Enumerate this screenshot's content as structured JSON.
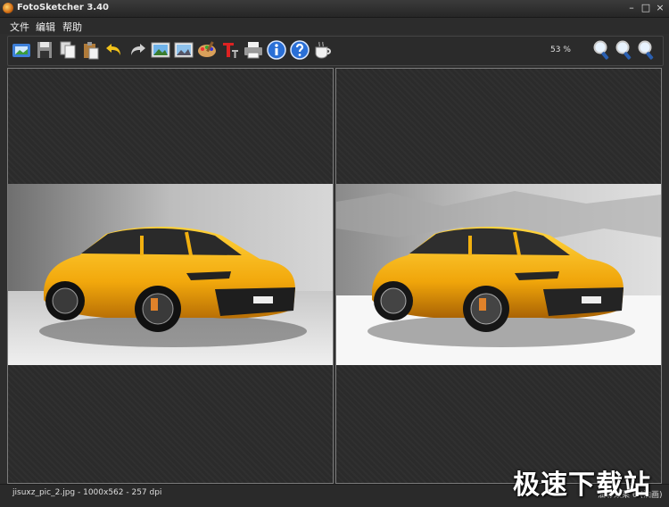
{
  "window": {
    "title": "FotoSketcher 3.40",
    "controls": [
      "–",
      "□",
      "×"
    ]
  },
  "menu": {
    "items": [
      "文件",
      "编辑",
      "帮助"
    ]
  },
  "toolbar": {
    "buttons": [
      {
        "name": "open-image-button",
        "icon": "folder-photo-icon"
      },
      {
        "name": "save-button",
        "icon": "floppy-disk-icon"
      },
      {
        "name": "copy-button",
        "icon": "copy-icon"
      },
      {
        "name": "paste-button",
        "icon": "paste-icon"
      },
      {
        "name": "undo-button",
        "icon": "undo-arrow-icon"
      },
      {
        "name": "redo-button",
        "icon": "redo-arrow-icon"
      },
      {
        "name": "original-image-button",
        "icon": "landscape-image-icon"
      },
      {
        "name": "result-image-button",
        "icon": "landscape-image-icon"
      },
      {
        "name": "drawing-parameters-button",
        "icon": "palette-icon"
      },
      {
        "name": "add-text-button",
        "icon": "text-tool-icon"
      },
      {
        "name": "print-button",
        "icon": "printer-icon"
      },
      {
        "name": "info-button",
        "icon": "info-icon"
      },
      {
        "name": "help-button",
        "icon": "help-icon"
      },
      {
        "name": "donate-button",
        "icon": "coffee-cup-icon"
      }
    ],
    "zoom_level": "53 %",
    "zoom_buttons": [
      {
        "name": "zoom-in-button",
        "icon": "magnifier-icon"
      },
      {
        "name": "zoom-out-button",
        "icon": "magnifier-icon"
      },
      {
        "name": "zoom-fit-button",
        "icon": "magnifier-icon"
      }
    ]
  },
  "panes": {
    "left": {
      "label": "original-image-pane"
    },
    "right": {
      "label": "result-image-pane"
    }
  },
  "status": {
    "file_info": "jisuxz_pic_2.jpg - 1000x562 - 257 dpi",
    "effect_info": "油彩效果 6 (油画)"
  },
  "watermark": "极速下载站",
  "colors": {
    "car_yellow": "#f2b00f",
    "background": "#2e2e2e",
    "pane_border": "#7c7c7c"
  }
}
